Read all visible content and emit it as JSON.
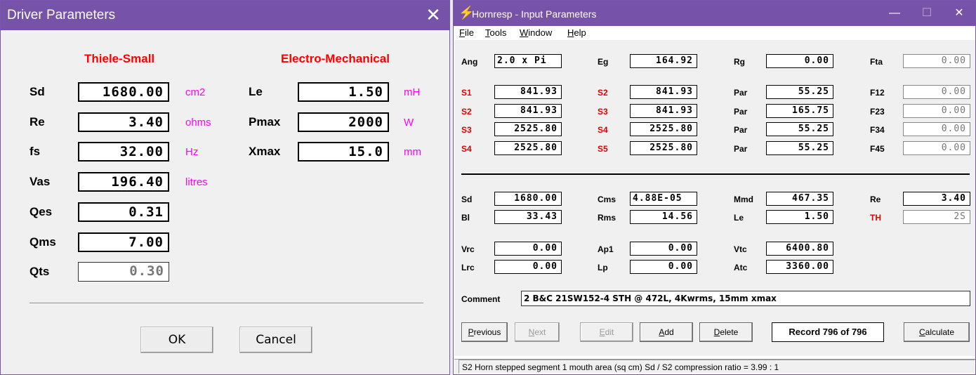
{
  "driver_dialog": {
    "title": "Driver Parameters",
    "close_glyph": "✕",
    "thiele_small_heading": "Thiele-Small",
    "electro_mechanical_heading": "Electro-Mechanical",
    "thiele_small": [
      {
        "label": "Sd",
        "value": "1680.00",
        "unit": "cm2"
      },
      {
        "label": "Re",
        "value": "3.40",
        "unit": "ohms"
      },
      {
        "label": "fs",
        "value": "32.00",
        "unit": "Hz"
      },
      {
        "label": "Vas",
        "value": "196.40",
        "unit": "litres"
      },
      {
        "label": "Qes",
        "value": "0.31",
        "unit": ""
      },
      {
        "label": "Qms",
        "value": "7.00",
        "unit": ""
      },
      {
        "label": "Qts",
        "value": "0.30",
        "unit": ""
      }
    ],
    "electro_mechanical": [
      {
        "label": "Le",
        "value": "1.50",
        "unit": "mH"
      },
      {
        "label": "Pmax",
        "value": "2000",
        "unit": "W"
      },
      {
        "label": "Xmax",
        "value": "15.0",
        "unit": "mm"
      }
    ],
    "ok_label": "OK",
    "cancel_label": "Cancel"
  },
  "hornresp": {
    "title": "Hornresp - Input Parameters",
    "title_icon": "lightning-bolt-icon",
    "minimize_glyph": "—",
    "maximize_glyph": "☐",
    "close_glyph": "✕",
    "menu": [
      "File",
      "Tools",
      "Window",
      "Help"
    ],
    "menu_underline": [
      "F",
      "T",
      "W",
      "H"
    ],
    "top": {
      "ang_label": "Ang",
      "ang_value": "2.0 x Pi",
      "eg_label": "Eg",
      "eg_value": "164.92",
      "rg_label": "Rg",
      "rg_value": "0.00",
      "fta_label": "Fta",
      "fta_value": "0.00"
    },
    "segments": [
      {
        "a": "S1",
        "av": "841.93",
        "b": "S2",
        "bv": "841.93",
        "par": "Par",
        "parv": "55.25",
        "f": "F12",
        "fv": "0.00"
      },
      {
        "a": "S2",
        "av": "841.93",
        "b": "S3",
        "bv": "841.93",
        "par": "Par",
        "parv": "165.75",
        "f": "F23",
        "fv": "0.00"
      },
      {
        "a": "S3",
        "av": "2525.80",
        "b": "S4",
        "bv": "2525.80",
        "par": "Par",
        "parv": "55.25",
        "f": "F34",
        "fv": "0.00"
      },
      {
        "a": "S4",
        "av": "2525.80",
        "b": "S5",
        "bv": "2525.80",
        "par": "Par",
        "parv": "55.25",
        "f": "F45",
        "fv": "0.00"
      }
    ],
    "driver": {
      "sd_label": "Sd",
      "sd": "1680.00",
      "cms_label": "Cms",
      "cms": "4.88E-05",
      "mmd_label": "Mmd",
      "mmd": "467.35",
      "re_label": "Re",
      "re": "3.40",
      "bl_label": "Bl",
      "bl": "33.43",
      "rms_label": "Rms",
      "rms": "14.56",
      "le_label": "Le",
      "le": "1.50",
      "th_label": "TH",
      "th": "2S"
    },
    "chamber": {
      "vrc_label": "Vrc",
      "vrc": "0.00",
      "ap1_label": "Ap1",
      "ap1": "0.00",
      "vtc_label": "Vtc",
      "vtc": "6400.80",
      "lrc_label": "Lrc",
      "lrc": "0.00",
      "lp_label": "Lp",
      "lp": "0.00",
      "atc_label": "Atc",
      "atc": "3360.00"
    },
    "comment_label": "Comment",
    "comment": "2 B&C 21SW152-4 STH @ 472L, 4Kwrms, 15mm xmax",
    "buttons": {
      "previous": "Previous",
      "next": "Next",
      "edit": "Edit",
      "add": "Add",
      "delete": "Delete",
      "record": "Record 796 of 796",
      "calculate": "Calculate"
    },
    "status": "S2   Horn stepped segment 1 mouth area  (sq cm)   Sd / S2 compression ratio = 3.99 : 1"
  },
  "colors": {
    "titlebar": "#7652a8",
    "heading_red": "#ff0000",
    "unit_magenta": "#ff00ff",
    "segment_label_red": "#e00000"
  }
}
